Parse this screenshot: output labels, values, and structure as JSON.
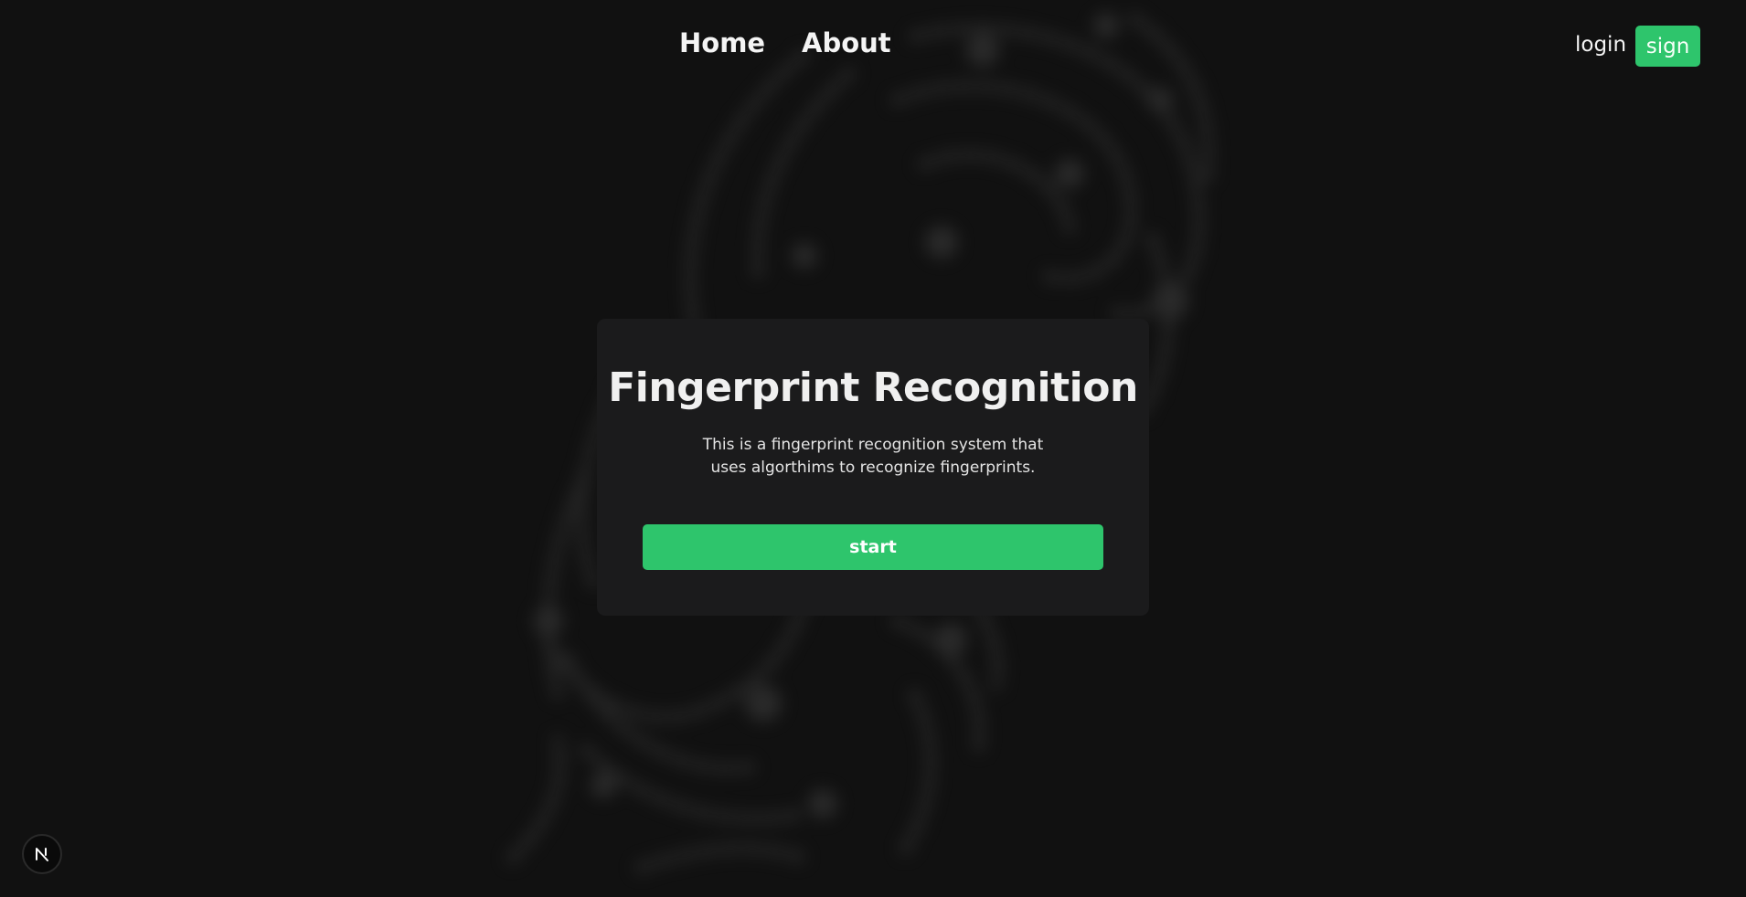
{
  "nav": {
    "home_label": "Home",
    "about_label": "About",
    "login_label": "login",
    "sign_label": "sign"
  },
  "hero": {
    "title": "Fingerprint Recognition",
    "description": "This is a fingerprint recognition system that uses algorthims to recognize fingerprints.",
    "start_label": "start"
  },
  "badge": {
    "letter": "N",
    "icon": "nextjs-logo-icon"
  },
  "colors": {
    "background": "#111111",
    "card": "#1b1b1c",
    "accent": "#2ec56c",
    "text": "#f2f2f2"
  }
}
